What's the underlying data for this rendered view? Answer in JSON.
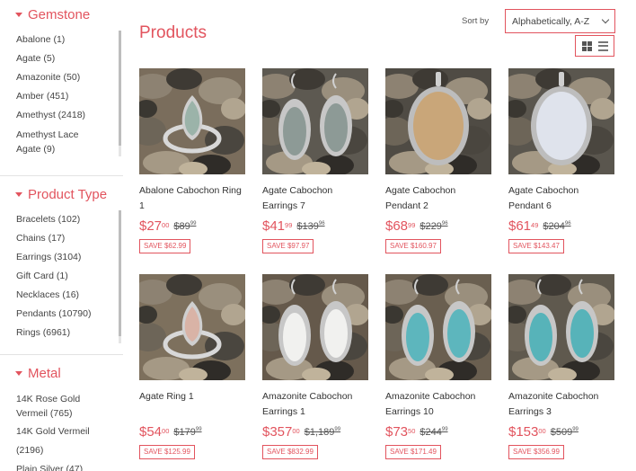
{
  "sidebar": {
    "groups": [
      {
        "title": "Gemstone",
        "items": [
          {
            "label": "Abalone (1)"
          },
          {
            "label": "Agate (5)"
          },
          {
            "label": "Amazonite (50)"
          },
          {
            "label": "Amber (451)"
          },
          {
            "label": "Amethyst (2418)"
          },
          {
            "label": "Amethyst Lace Agate (9)"
          }
        ]
      },
      {
        "title": "Product Type",
        "items": [
          {
            "label": "Bracelets (102)"
          },
          {
            "label": "Chains (17)"
          },
          {
            "label": "Earrings (3104)"
          },
          {
            "label": "Gift Card (1)"
          },
          {
            "label": "Necklaces (16)"
          },
          {
            "label": "Pendants (10790)"
          },
          {
            "label": "Rings (6961)"
          }
        ]
      },
      {
        "title": "Metal",
        "items": [
          {
            "label": "14K Rose Gold Vermeil (765)"
          },
          {
            "label": "14K Gold Vermeil (2196)"
          },
          {
            "label": "Plain Silver (47)"
          }
        ]
      }
    ]
  },
  "main": {
    "title": "Products",
    "sort_label": "Sort by",
    "sort_value": "Alphabetically, A-Z"
  },
  "products": [
    {
      "name": "Abalone Cabochon Ring 1",
      "price_whole": "$27",
      "price_cents": "00",
      "compare_whole": "$89",
      "compare_cents": "99",
      "save": "SAVE $62.99",
      "image": "ring-abalone",
      "bg": "#7a6d5c",
      "stone": "#9bb3a9"
    },
    {
      "name": "Agate Cabochon Earrings 7",
      "price_whole": "$41",
      "price_cents": "99",
      "compare_whole": "$139",
      "compare_cents": "96",
      "save": "SAVE $97.97",
      "image": "earrings-agate",
      "bg": "#5d5951",
      "stone": "#8d9a96"
    },
    {
      "name": "Agate Cabochon Pendant 2",
      "price_whole": "$68",
      "price_cents": "99",
      "compare_whole": "$229",
      "compare_cents": "96",
      "save": "SAVE $160.97",
      "image": "pendant-agate",
      "bg": "#4f4b44",
      "stone": "#c9a679"
    },
    {
      "name": "Agate Cabochon Pendant 6",
      "price_whole": "$61",
      "price_cents": "49",
      "compare_whole": "$204",
      "compare_cents": "96",
      "save": "SAVE $143.47",
      "image": "pendant-agate-6",
      "bg": "#5a564e",
      "stone": "#dfe3ec"
    },
    {
      "name": "Agate Ring 1",
      "price_whole": "$54",
      "price_cents": "00",
      "compare_whole": "$179",
      "compare_cents": "99",
      "save": "SAVE $125.99",
      "image": "ring-agate",
      "bg": "#7d705d",
      "stone": "#d9b3a6"
    },
    {
      "name": "Amazonite Cabochon Earrings 1",
      "price_whole": "$357",
      "price_cents": "00",
      "compare_whole": "$1,189",
      "compare_cents": "99",
      "save": "SAVE $832.99",
      "image": "earrings-amazonite-1",
      "bg": "#65594b",
      "stone": "#f1f1ef"
    },
    {
      "name": "Amazonite Cabochon Earrings 10",
      "price_whole": "$73",
      "price_cents": "50",
      "compare_whole": "$244",
      "compare_cents": "99",
      "save": "SAVE $171.49",
      "image": "earrings-amazonite-10",
      "bg": "#6a5f50",
      "stone": "#5db6bd"
    },
    {
      "name": "Amazonite Cabochon Earrings 3",
      "price_whole": "$153",
      "price_cents": "00",
      "compare_whole": "$509",
      "compare_cents": "99",
      "save": "SAVE $356.99",
      "image": "earrings-amazonite-3",
      "bg": "#5f594e",
      "stone": "#57b3b9"
    }
  ]
}
